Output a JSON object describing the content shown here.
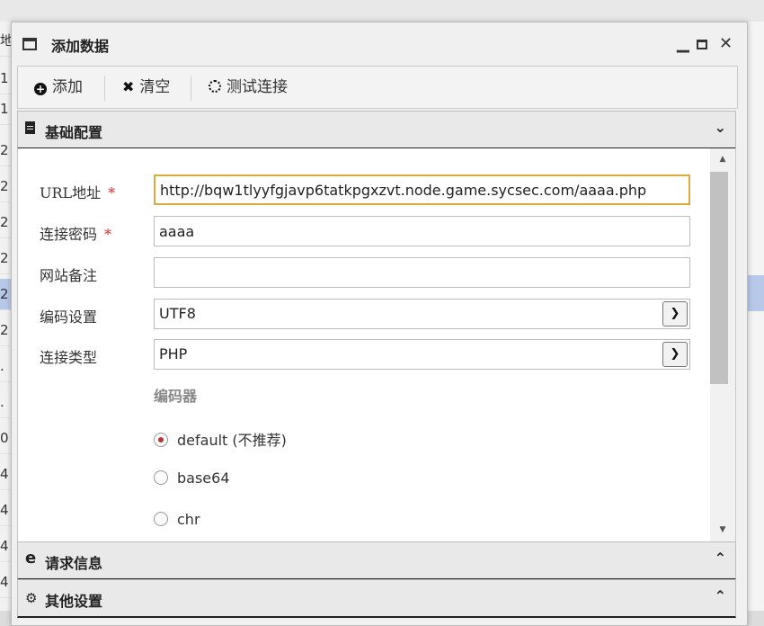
{
  "background": {
    "row_labels": [
      "地",
      "1",
      "1",
      "2",
      "2",
      "2",
      "2",
      "2",
      "2",
      ".",
      ".",
      "0",
      "4",
      "4",
      "4",
      "4"
    ]
  },
  "window": {
    "title": "添加数据",
    "min_symbol": "▁",
    "close_symbol": "✕"
  },
  "toolbar": {
    "add_label": "添加",
    "clear_label": "清空",
    "test_label": "测试连接"
  },
  "panels": {
    "basic": {
      "title": "基础配置",
      "icon": "document-icon",
      "chevron": "⌄"
    },
    "request": {
      "title": "请求信息",
      "icon": "e-icon",
      "chevron": "⌃"
    },
    "other": {
      "title": "其他设置",
      "icon": "gears-icon",
      "chevron": "⌃"
    }
  },
  "form": {
    "url": {
      "label": "URL地址",
      "required": "*",
      "value": "http://bqw1tlyyfgjavp6tatkpgxzvt.node.game.sycsec.com/aaaa.php"
    },
    "password": {
      "label": "连接密码",
      "required": "*",
      "value": "aaaa"
    },
    "note": {
      "label": "网站备注",
      "value": ""
    },
    "encoding": {
      "label": "编码设置",
      "value": "UTF8"
    },
    "type": {
      "label": "连接类型",
      "value": "PHP"
    },
    "encoder": {
      "heading": "编码器",
      "options": [
        {
          "label": "default (不推荐)",
          "selected": true
        },
        {
          "label": "base64",
          "selected": false
        },
        {
          "label": "chr",
          "selected": false
        }
      ]
    }
  },
  "colors": {
    "focus_border": "#e0a93c",
    "required": "#d32f2f",
    "highlight_row": "#b8c8e8"
  }
}
